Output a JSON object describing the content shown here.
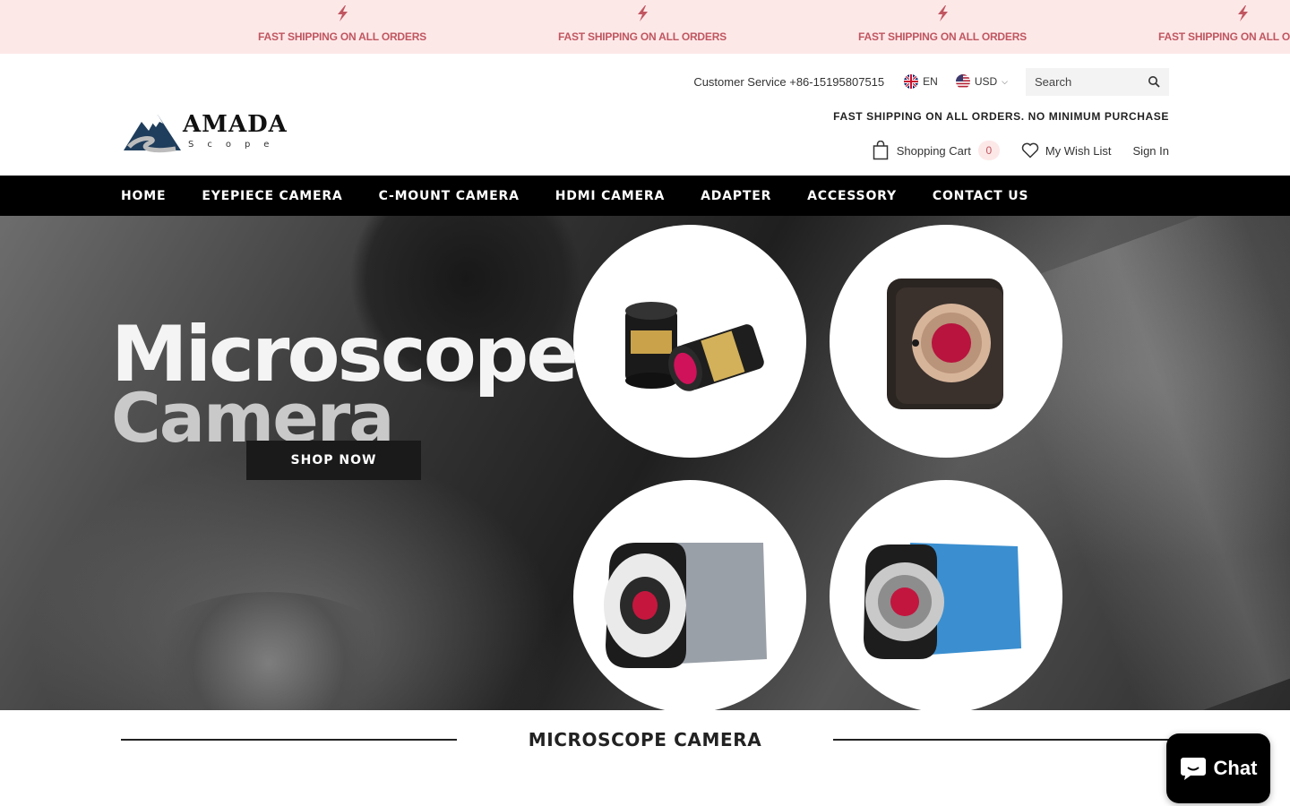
{
  "announcement": {
    "items": [
      "FAST SHIPPING ON ALL ORDERS",
      "FAST SHIPPING ON ALL ORDERS",
      "FAST SHIPPING ON ALL ORDERS",
      "FAST SHIPPING ON ALL ORDERS"
    ],
    "icon": "lightning-bolt-icon",
    "bg_color": "#fde8e8",
    "text_color": "#c05660"
  },
  "header": {
    "logo_text": "AMADA",
    "logo_sub": "Scope",
    "customer_service": "Customer Service +86-15195807515",
    "language": "EN",
    "currency": "USD",
    "search_placeholder": "Search",
    "promo": "FAST SHIPPING ON ALL ORDERS. NO MINIMUM PURCHASE",
    "cart_label": "Shopping Cart",
    "cart_count": "0",
    "wishlist_label": "My Wish List",
    "signin_label": "Sign In"
  },
  "nav": {
    "items": [
      "HOME",
      "EYEPIECE CAMERA",
      "C-MOUNT CAMERA",
      "HDMI CAMERA",
      "ADAPTER",
      "ACCESSORY",
      "CONTACT US"
    ]
  },
  "hero": {
    "title_line1": "Microscope",
    "title_line2": "Camera",
    "button_label": "SHOP NOW"
  },
  "section": {
    "title": "MICROSCOPE CAMERA"
  },
  "chat": {
    "label": "Chat"
  }
}
